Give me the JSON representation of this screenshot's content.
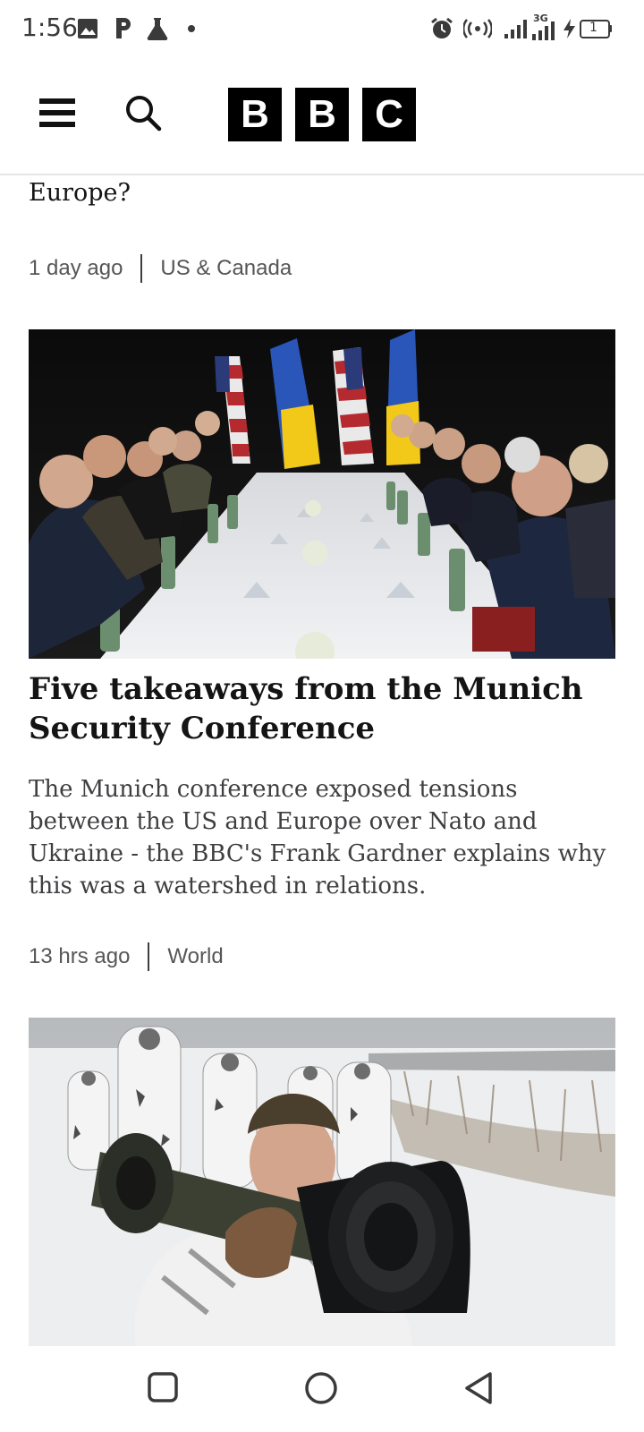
{
  "status_bar": {
    "time": "1:56",
    "left_icons": [
      "image-icon",
      "p-app-icon",
      "flask-icon",
      "dot-icon"
    ],
    "right_icons": [
      "alarm-icon",
      "hotspot-icon",
      "signal-icon",
      "signal-3g-icon",
      "charging-icon",
      "battery-icon"
    ],
    "network_label": "3G",
    "battery_level": "1"
  },
  "header": {
    "logo_letters": [
      "B",
      "B",
      "C"
    ]
  },
  "previous_article": {
    "title_fragment": "Europe?",
    "time": "1 day ago",
    "section": "US & Canada"
  },
  "articles": [
    {
      "title": "Five takeaways from the Munich Security Conference",
      "summary": "The Munich conference exposed tensions between the US and Europe over Nato and Ukraine - the BBC's Frank Gardner explains why this was a watershed in relations.",
      "time": "13 hrs ago",
      "section": "World"
    }
  ],
  "next_article": {
    "image_subject": "soldiers-in-snow-photo"
  },
  "nav_bar": {
    "buttons": [
      "recents-button",
      "home-button",
      "back-button"
    ]
  }
}
